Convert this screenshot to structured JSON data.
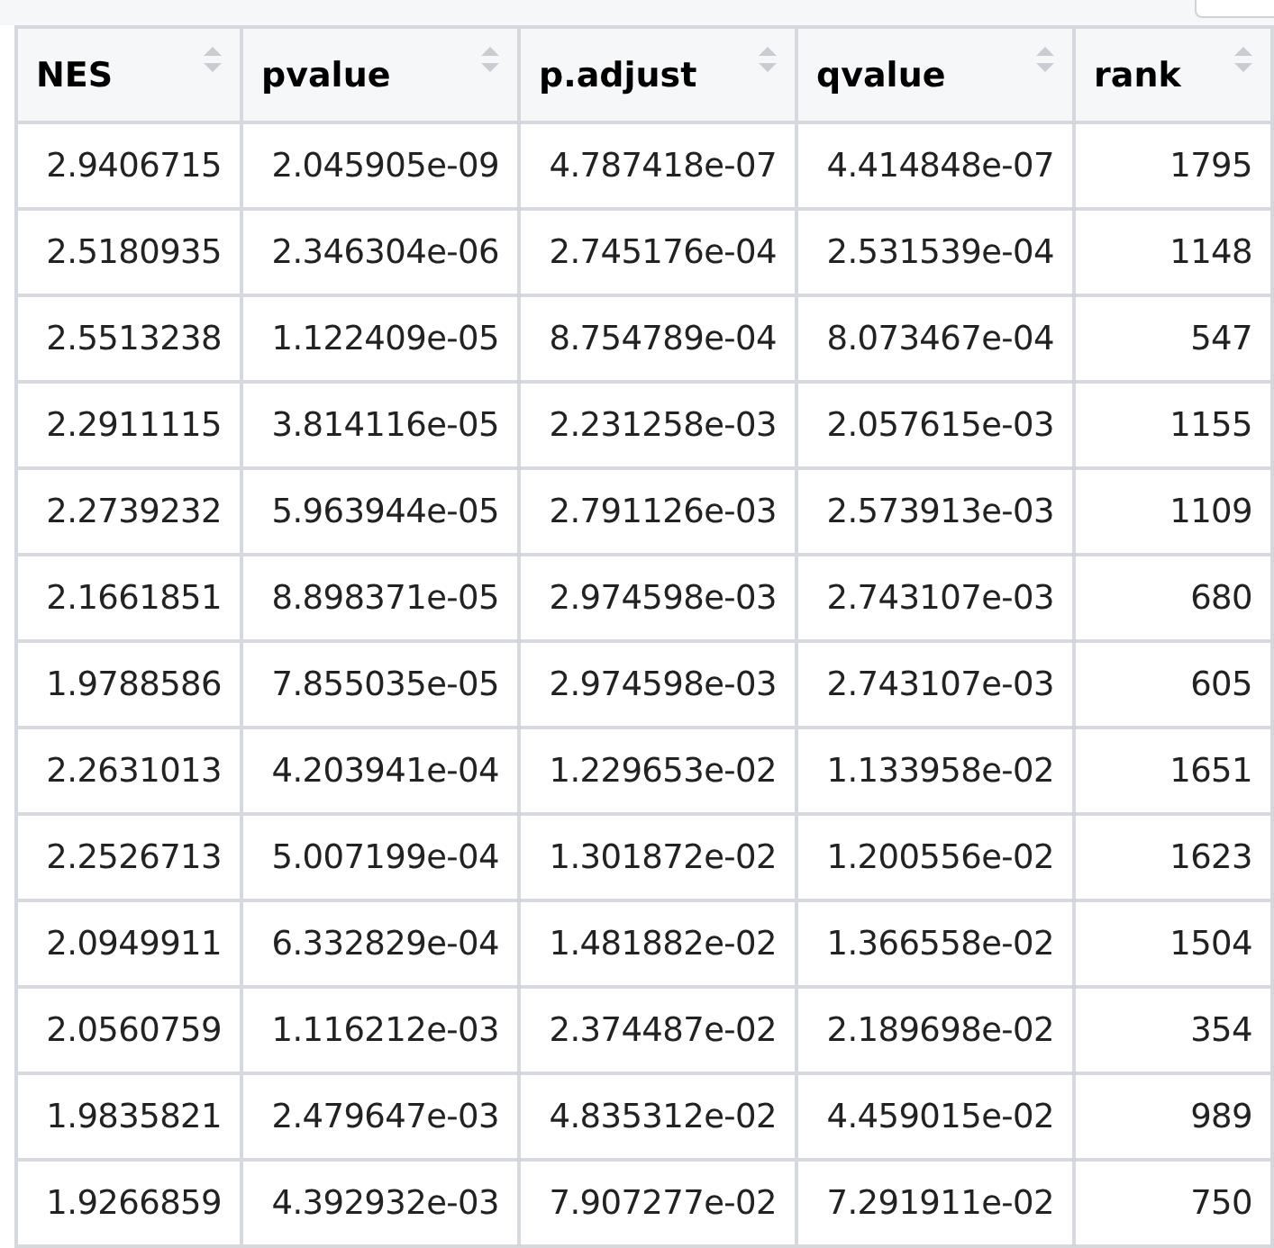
{
  "table": {
    "columns": [
      "NES",
      "pvalue",
      "p.adjust",
      "qvalue",
      "rank"
    ],
    "rows": [
      [
        "2.9406715",
        "2.045905e-09",
        "4.787418e-07",
        "4.414848e-07",
        "1795"
      ],
      [
        "2.5180935",
        "2.346304e-06",
        "2.745176e-04",
        "2.531539e-04",
        "1148"
      ],
      [
        "2.5513238",
        "1.122409e-05",
        "8.754789e-04",
        "8.073467e-04",
        "547"
      ],
      [
        "2.2911115",
        "3.814116e-05",
        "2.231258e-03",
        "2.057615e-03",
        "1155"
      ],
      [
        "2.2739232",
        "5.963944e-05",
        "2.791126e-03",
        "2.573913e-03",
        "1109"
      ],
      [
        "2.1661851",
        "8.898371e-05",
        "2.974598e-03",
        "2.743107e-03",
        "680"
      ],
      [
        "1.9788586",
        "7.855035e-05",
        "2.974598e-03",
        "2.743107e-03",
        "605"
      ],
      [
        "2.2631013",
        "4.203941e-04",
        "1.229653e-02",
        "1.133958e-02",
        "1651"
      ],
      [
        "2.2526713",
        "5.007199e-04",
        "1.301872e-02",
        "1.200556e-02",
        "1623"
      ],
      [
        "2.0949911",
        "6.332829e-04",
        "1.481882e-02",
        "1.366558e-02",
        "1504"
      ],
      [
        "2.0560759",
        "1.116212e-03",
        "2.374487e-02",
        "2.189698e-02",
        "354"
      ],
      [
        "1.9835821",
        "2.479647e-03",
        "4.835312e-02",
        "4.459015e-02",
        "989"
      ],
      [
        "1.9266859",
        "4.392932e-03",
        "7.907277e-02",
        "7.291911e-02",
        "750"
      ]
    ]
  }
}
